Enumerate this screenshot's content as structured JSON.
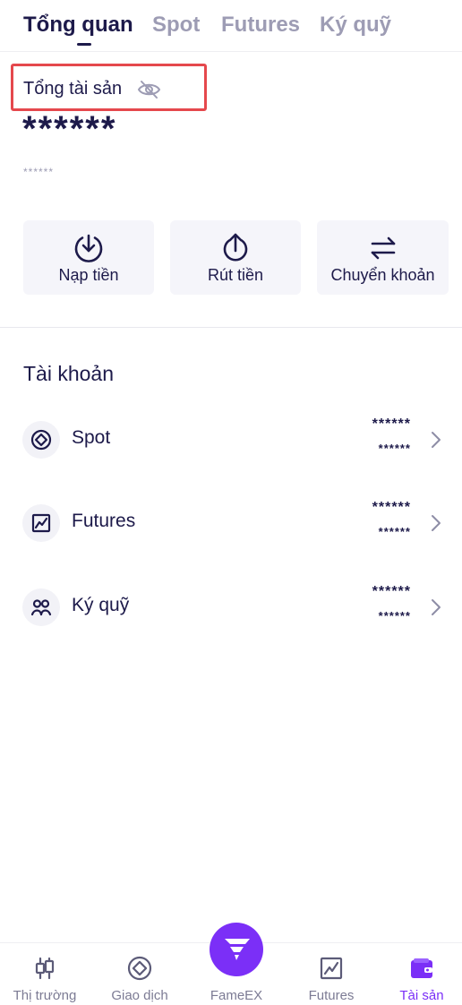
{
  "tabs": [
    {
      "label": "Tổng quan",
      "active": true
    },
    {
      "label": "Spot",
      "active": false
    },
    {
      "label": "Futures",
      "active": false
    },
    {
      "label": "Ký quỹ",
      "active": false
    }
  ],
  "total": {
    "label": "Tổng tài sản",
    "toggle_icon": "eye-off-icon",
    "balance_main": "******",
    "balance_sub": "******"
  },
  "actions": [
    {
      "label": "Nạp tiền",
      "icon": "deposit-icon"
    },
    {
      "label": "Rút tiền",
      "icon": "withdraw-icon"
    },
    {
      "label": "Chuyển khoản",
      "icon": "transfer-icon"
    }
  ],
  "accounts": {
    "title": "Tài khoản",
    "items": [
      {
        "name": "Spot",
        "icon": "spot-icon",
        "value": "******",
        "sub_value": "******"
      },
      {
        "name": "Futures",
        "icon": "futures-chart-icon",
        "value": "******",
        "sub_value": "******"
      },
      {
        "name": "Ký quỹ",
        "icon": "margin-users-icon",
        "value": "******",
        "sub_value": "******"
      }
    ]
  },
  "bottom_nav": [
    {
      "label": "Thị trường",
      "icon": "candlestick-icon",
      "active": false
    },
    {
      "label": "Giao dịch",
      "icon": "trade-icon",
      "active": false
    },
    {
      "label": "FameEX",
      "icon": "fameex-logo-icon",
      "active": false
    },
    {
      "label": "Futures",
      "icon": "futures-chart-icon",
      "active": false
    },
    {
      "label": "Tài sản",
      "icon": "wallet-icon",
      "active": true
    }
  ],
  "colors": {
    "primary_text": "#1d1a4a",
    "muted_text": "#9d9cb4",
    "accent": "#7b2ff7",
    "highlight_border": "#e5484d"
  }
}
